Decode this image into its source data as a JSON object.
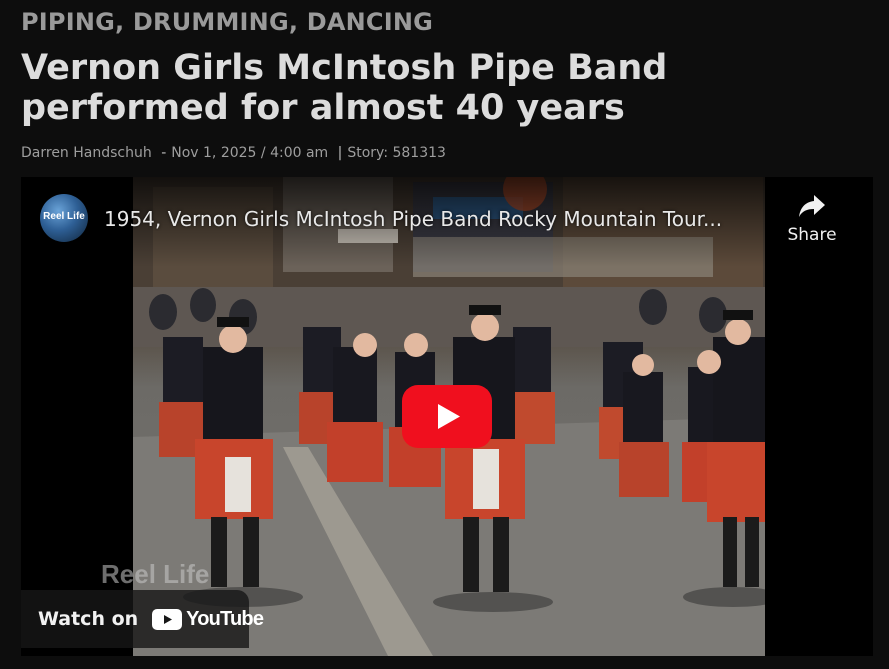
{
  "article": {
    "category": "PIPING, DRUMMING, DANCING",
    "headline": "Vernon Girls McIntosh Pipe Band performed for almost 40 years",
    "author": "Darren Handschuh",
    "date": "Nov 1, 2025 / 4:00 am",
    "story": "Story: 581313"
  },
  "video": {
    "channel_avatar_text": "Reel Life",
    "title": "1954, Vernon Girls McIntosh Pipe Band Rocky Mountain Tour...",
    "share_label": "Share",
    "share_icon": "share-arrow-icon",
    "play_icon": "play-icon",
    "watermark": "Reel Life",
    "watch_on_label": "Watch on",
    "youtube_label": "YouTube",
    "colors": {
      "play_red": "#ff0000",
      "kilt_red": "#c2402a",
      "jacket": "#1a1a22"
    }
  }
}
